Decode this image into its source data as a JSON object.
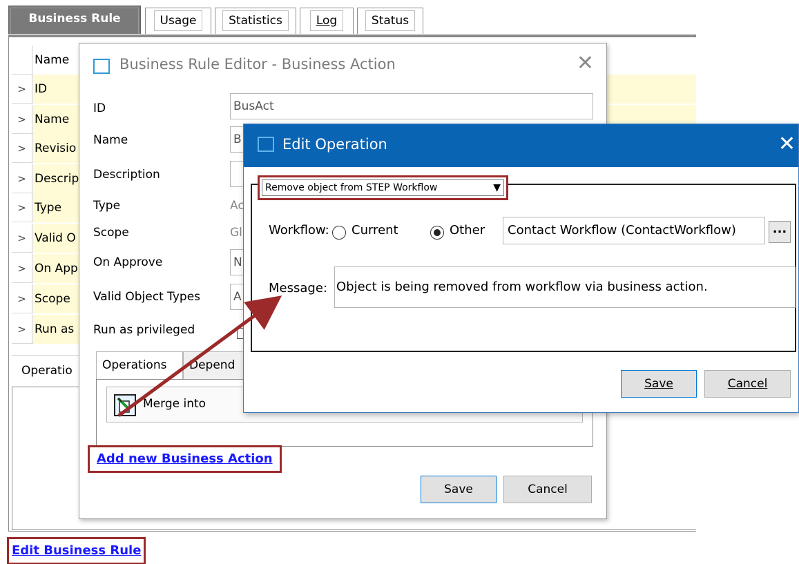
{
  "tabs": {
    "business_rule": "Business Rule",
    "usage": "Usage",
    "statistics": "Statistics",
    "log": "Log",
    "status": "Status"
  },
  "grid": {
    "header": "Name",
    "rows": [
      "ID",
      "Name",
      "Revisio",
      "Descrip",
      "Type",
      "Valid O",
      "On App",
      "Scope",
      "Run as"
    ],
    "arrow": ">"
  },
  "base_ops_tab": "Operatio",
  "edit_business_rule": "Edit Business Rule",
  "editor": {
    "title": "Business Rule Editor - Business Action",
    "close": "✕",
    "labels": {
      "id": "ID",
      "name": "Name",
      "description": "Description",
      "type": "Type",
      "scope": "Scope",
      "on_approve": "On Approve",
      "valid_object_types": "Valid Object Types",
      "run_as_privileged": "Run as privileged"
    },
    "values": {
      "id": "BusAct",
      "name": "B",
      "type": "Ac",
      "scope": "Gl",
      "on_approve": "N",
      "valid_object_types": "A"
    },
    "inner_tabs": {
      "operations": "Operations",
      "dependencies": "Depend"
    },
    "operation_item": "Merge  into",
    "add_action": "Add new Business Action",
    "save": "Save",
    "cancel": "Cancel"
  },
  "edit_operation": {
    "title": "Edit Operation",
    "close": "✕",
    "operation_type": "Remove object from STEP Workflow",
    "workflow_label": "Workflow:",
    "radio_current": "Current",
    "radio_other": "Other",
    "selected_radio": "Other",
    "workflow_value": "Contact Workflow (ContactWorkflow)",
    "browse": "...",
    "message_label": "Message:",
    "message_value": "Object is being removed from workflow via business action.",
    "save": "Save",
    "cancel": "Cancel"
  },
  "colors": {
    "highlight_border": "#9c2a2a",
    "title_bar": "#0a64b4",
    "row_fill": "#fffbd6",
    "link": "#1a1aff",
    "arrow": "#9c2a2a"
  }
}
